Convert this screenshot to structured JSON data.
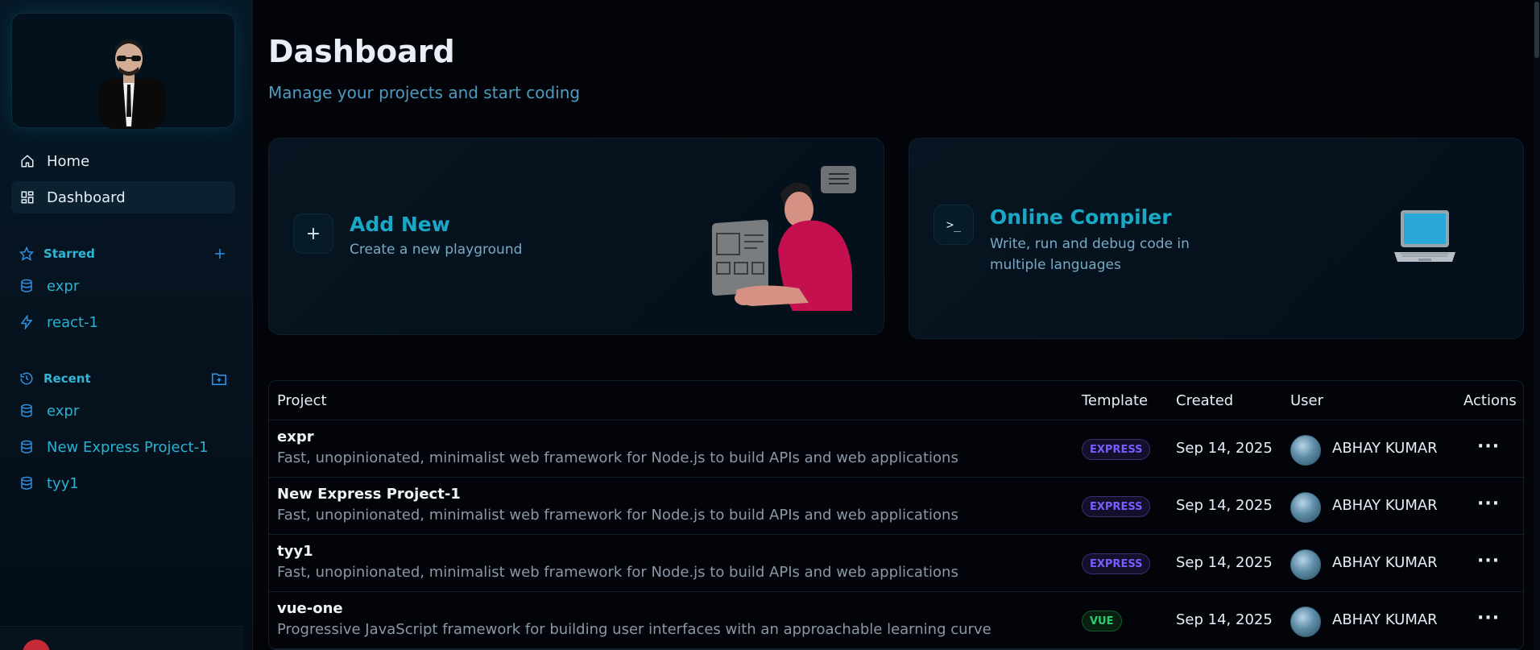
{
  "sidebar": {
    "nav": [
      {
        "label": "Home",
        "icon": "home-icon"
      },
      {
        "label": "Dashboard",
        "icon": "dashboard-icon"
      }
    ],
    "starred": {
      "heading": "Starred",
      "items": [
        {
          "label": "expr",
          "icon": "database-icon"
        },
        {
          "label": "react-1",
          "icon": "zap-icon"
        }
      ]
    },
    "recent": {
      "heading": "Recent",
      "items": [
        {
          "label": "expr"
        },
        {
          "label": "New Express Project-1"
        },
        {
          "label": "tyy1"
        }
      ]
    }
  },
  "header": {
    "title": "Dashboard",
    "subtitle": "Manage your projects and start coding"
  },
  "cards": {
    "add_new": {
      "title": "Add New",
      "description": "Create a new playground",
      "icon": "+"
    },
    "compiler": {
      "title": "Online Compiler",
      "description_line1": "Write, run and debug code in",
      "description_line2": "multiple languages",
      "icon": ">_"
    }
  },
  "table": {
    "headers": {
      "project": "Project",
      "template": "Template",
      "created": "Created",
      "user": "User",
      "actions": "Actions"
    },
    "rows": [
      {
        "name": "expr",
        "description": "Fast, unopinionated, minimalist web framework for Node.js to build APIs and web applications",
        "template": "EXPRESS",
        "created": "Sep 14, 2025",
        "user": "ABHAY KUMAR",
        "actions": "···"
      },
      {
        "name": "New Express Project-1",
        "description": "Fast, unopinionated, minimalist web framework for Node.js to build APIs and web applications",
        "template": "EXPRESS",
        "created": "Sep 14, 2025",
        "user": "ABHAY KUMAR",
        "actions": "···"
      },
      {
        "name": "tyy1",
        "description": "Fast, unopinionated, minimalist web framework for Node.js to build APIs and web applications",
        "template": "EXPRESS",
        "created": "Sep 14, 2025",
        "user": "ABHAY KUMAR",
        "actions": "···"
      },
      {
        "name": "vue-one",
        "description": "Progressive JavaScript framework for building user interfaces with an approachable learning curve",
        "template": "VUE",
        "created": "Sep 14, 2025",
        "user": "ABHAY KUMAR",
        "actions": "···"
      }
    ]
  },
  "colors": {
    "accent": "#1aa8c6",
    "express_badge": "#7b5cff",
    "vue_badge": "#2ecc71"
  }
}
